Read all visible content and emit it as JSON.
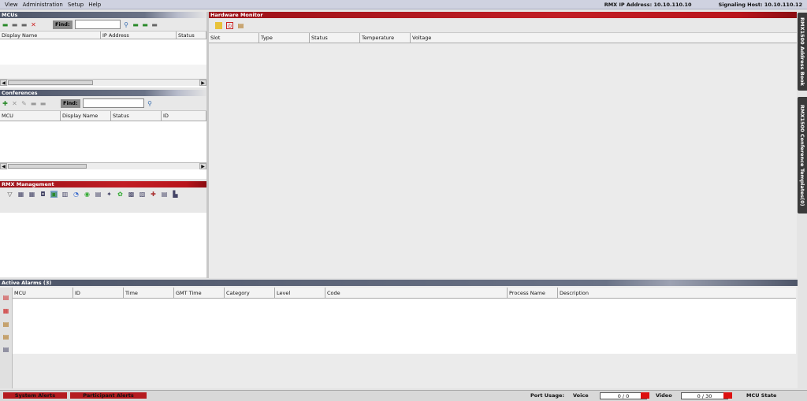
{
  "menu": {
    "items": [
      "View",
      "Administration",
      "Setup",
      "Help"
    ],
    "rmx_ip": "RMX IP Address: 10.10.110.10",
    "signaling": "Signaling Host: 10.10.110.12"
  },
  "mcus": {
    "title": "MCUs",
    "find_label": "Find:",
    "columns": [
      "Display Name",
      "IP Address",
      "Status"
    ]
  },
  "conferences": {
    "title": "Conferences",
    "find_label": "Find:",
    "columns": [
      "MCU",
      "Display Name",
      "Status",
      "ID"
    ]
  },
  "rmx_management": {
    "title": "RMX Management"
  },
  "hardware": {
    "title": "Hardware Monitor",
    "columns": [
      "Slot",
      "Type",
      "Status",
      "Temperature",
      "Voltage"
    ]
  },
  "alarms": {
    "title": "Active Alarms (3)",
    "columns": [
      "MCU",
      "ID",
      "Time",
      "GMT Time",
      "Category",
      "Level",
      "Code",
      "Process Name",
      "Description"
    ]
  },
  "side_tabs": [
    "RMX1500 Address Book",
    "RMX1500 Conference Templates(0)"
  ],
  "status": {
    "system_alerts": "System Alerts",
    "participant_alerts": "Participant Alerts",
    "port_usage": "Port Usage:",
    "voice_label": "Voice",
    "voice_value": "0 / 0",
    "video_label": "Video",
    "video_value": "0 / 30",
    "mcu_state": "MCU State"
  },
  "colors": {
    "accent_red": "#b51b1f",
    "header_gray": "#4d5568"
  }
}
